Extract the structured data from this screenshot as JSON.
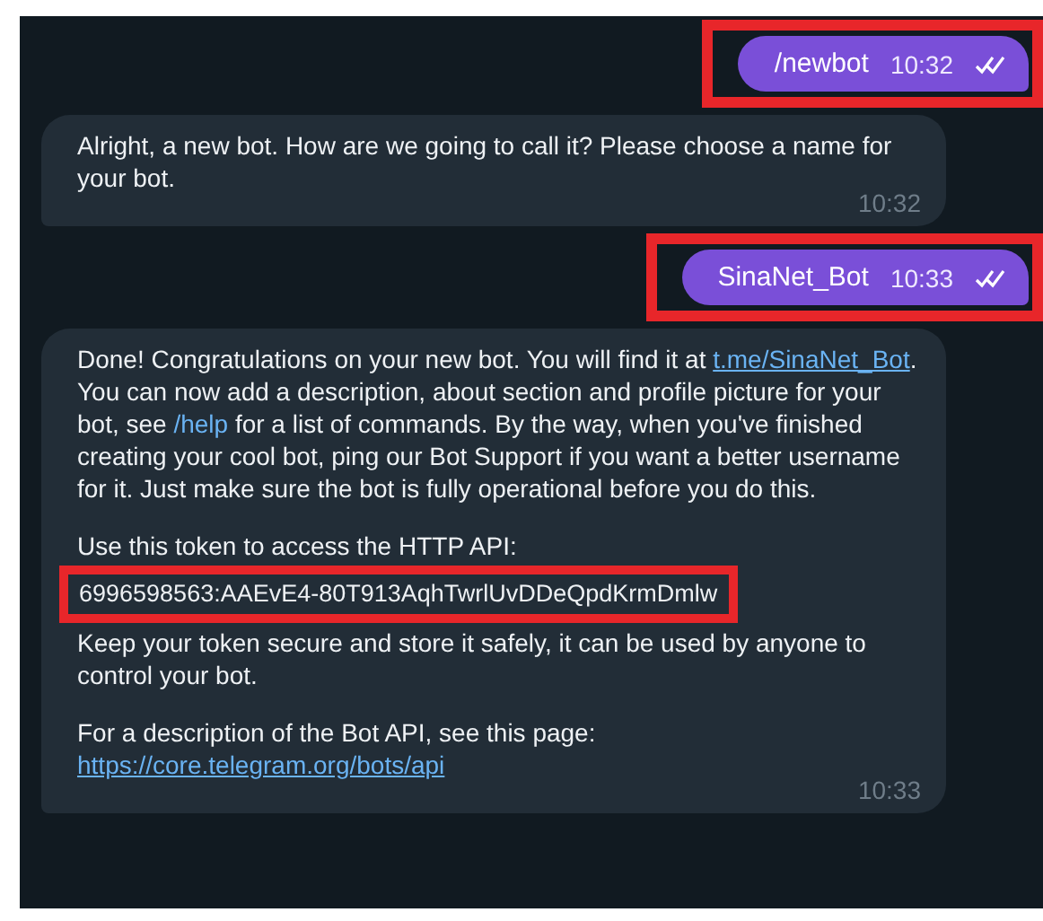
{
  "messages": [
    {
      "kind": "outgoing",
      "text": "/newbot",
      "time": "10:32",
      "read": true,
      "highlighted": true
    },
    {
      "kind": "incoming",
      "time": "10:32",
      "paragraphs": [
        {
          "segments": [
            {
              "kind": "text",
              "text": "Alright, a new bot. How are we going to call it? Please choose a name for your bot."
            }
          ]
        }
      ]
    },
    {
      "kind": "outgoing",
      "text": "SinaNet_Bot",
      "time": "10:33",
      "read": true,
      "highlighted": true
    },
    {
      "kind": "incoming",
      "time": "10:33",
      "paragraphs": [
        {
          "segments": [
            {
              "kind": "text",
              "text": "Done! Congratulations on your new bot. You will find it at "
            },
            {
              "kind": "link",
              "text": "t.me/SinaNet_Bot"
            },
            {
              "kind": "text",
              "text": ". You can now add a description, about section and profile picture for your bot, see "
            },
            {
              "kind": "command",
              "text": "/help"
            },
            {
              "kind": "text",
              "text": " for a list of commands. By the way, when you've finished creating your cool bot, ping our Bot Support if you want a better username for it. Just make sure the bot is fully operational before you do this."
            }
          ]
        },
        {
          "spaced": true,
          "segments": [
            {
              "kind": "text",
              "text": "Use this token to access the HTTP API:"
            }
          ]
        },
        {
          "highlighted": true,
          "segments": [
            {
              "kind": "text",
              "text": "6996598563:AAEvE4-80T913AqhTwrlUvDDeQpdKrmDmlw"
            }
          ]
        },
        {
          "segments": [
            {
              "kind": "text",
              "text": "Keep your token secure and store it safely, it can be used by anyone to control your bot."
            }
          ]
        },
        {
          "spaced": true,
          "segments": [
            {
              "kind": "text",
              "text": "For a description of the Bot API, see this page: "
            },
            {
              "kind": "link",
              "text": "https://core.telegram.org/bots/api"
            }
          ]
        }
      ]
    }
  ]
}
